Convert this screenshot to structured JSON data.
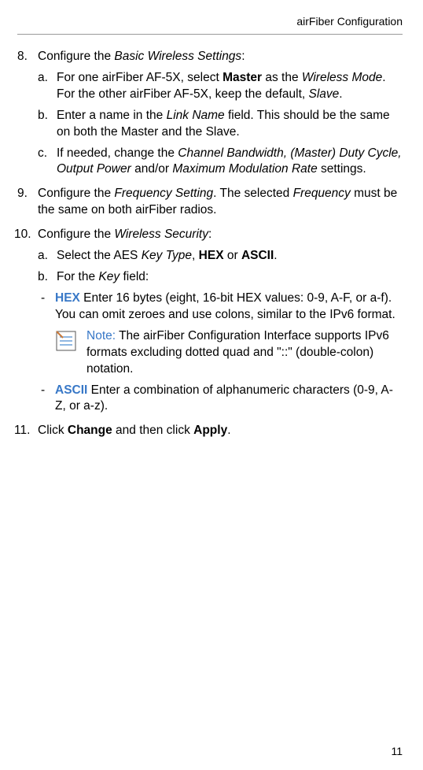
{
  "header": {
    "title": "airFiber Configuration"
  },
  "step8": {
    "num": "8.",
    "pre": "Configure the ",
    "italic": "Basic Wireless Settings",
    "post": ":",
    "a": {
      "mark": "a.",
      "t1": "For one airFiber AF-5X, select ",
      "bold1": "Master",
      "t2": " as the ",
      "italic1": "Wireless Mode",
      "t3": ". For the other airFiber AF-5X, keep the default, ",
      "italic2": "Slave",
      "t4": "."
    },
    "b": {
      "mark": "b.",
      "t1": "Enter a name in the ",
      "italic1": "Link Name",
      "t2": " field. This should be the same on both the Master and the Slave."
    },
    "c": {
      "mark": "c.",
      "t1": "If needed, change the ",
      "italic1": "Channel Bandwidth, (Master) Duty Cycle, Output Power ",
      "t2": "and/or ",
      "italic2": "Maximum Modulation Rate",
      "t3": " settings."
    }
  },
  "step9": {
    "num": "9.",
    "t1": "Configure the ",
    "italic1": "Frequency Setting",
    "t2": ". The selected ",
    "italic2": "Frequency",
    "t3": " must be the same on both airFiber radios."
  },
  "step10": {
    "num": "10.",
    "t1": "Configure the ",
    "italic1": "Wireless Security",
    "t2": ":",
    "a": {
      "mark": "a.",
      "t1": "Select the AES ",
      "italic1": "Key Type",
      "t2": ", ",
      "bold1": "HEX",
      "t3": " or ",
      "bold2": "ASCII",
      "t4": "."
    },
    "b": {
      "mark": "b.",
      "t1": "For the ",
      "italic1": "Key",
      "t2": " field:"
    },
    "hex": {
      "mark": "-",
      "label": "HEX",
      "text": "  Enter 16 bytes (eight, 16-bit HEX values: 0-9, A-F, or a-f). You can omit zeroes and use colons, similar to the IPv6 format."
    },
    "note": {
      "label": "Note:",
      "text": " The airFiber Configuration Interface supports IPv6 formats excluding dotted quad and \"::\" (double-colon) notation."
    },
    "ascii": {
      "mark": "-",
      "label": "ASCII",
      "text": "  Enter a combination of alphanumeric characters (0-9, A-Z, or a-z)."
    }
  },
  "step11": {
    "num": "11.",
    "t1": "Click ",
    "bold1": "Change",
    "t2": " and then click ",
    "bold2": "Apply",
    "t3": "."
  },
  "page": {
    "number": "11"
  }
}
